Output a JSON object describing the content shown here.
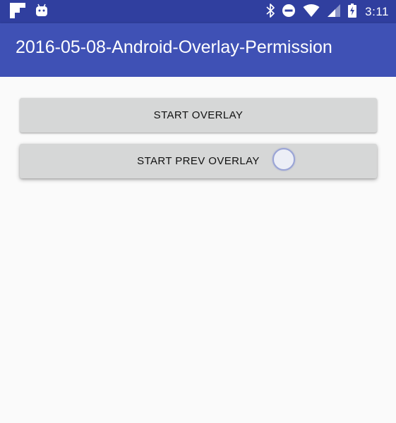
{
  "status_bar": {
    "left_icons": [
      "flipboard-icon",
      "android-icon"
    ],
    "right_icons": [
      "bluetooth-icon",
      "do-not-disturb-icon",
      "wifi-icon",
      "cellular-signal-icon",
      "battery-charging-icon"
    ],
    "time": "3:11"
  },
  "app_bar": {
    "title": "2016-05-08-Android-Overlay-Permission"
  },
  "buttons": {
    "start_overlay": "START OVERLAY",
    "start_prev_overlay": "START PREV OVERLAY"
  },
  "colors": {
    "status_bar": "#303f9f",
    "app_bar": "#3f51b5",
    "button": "#d6d7d7",
    "background": "#fafafa"
  }
}
